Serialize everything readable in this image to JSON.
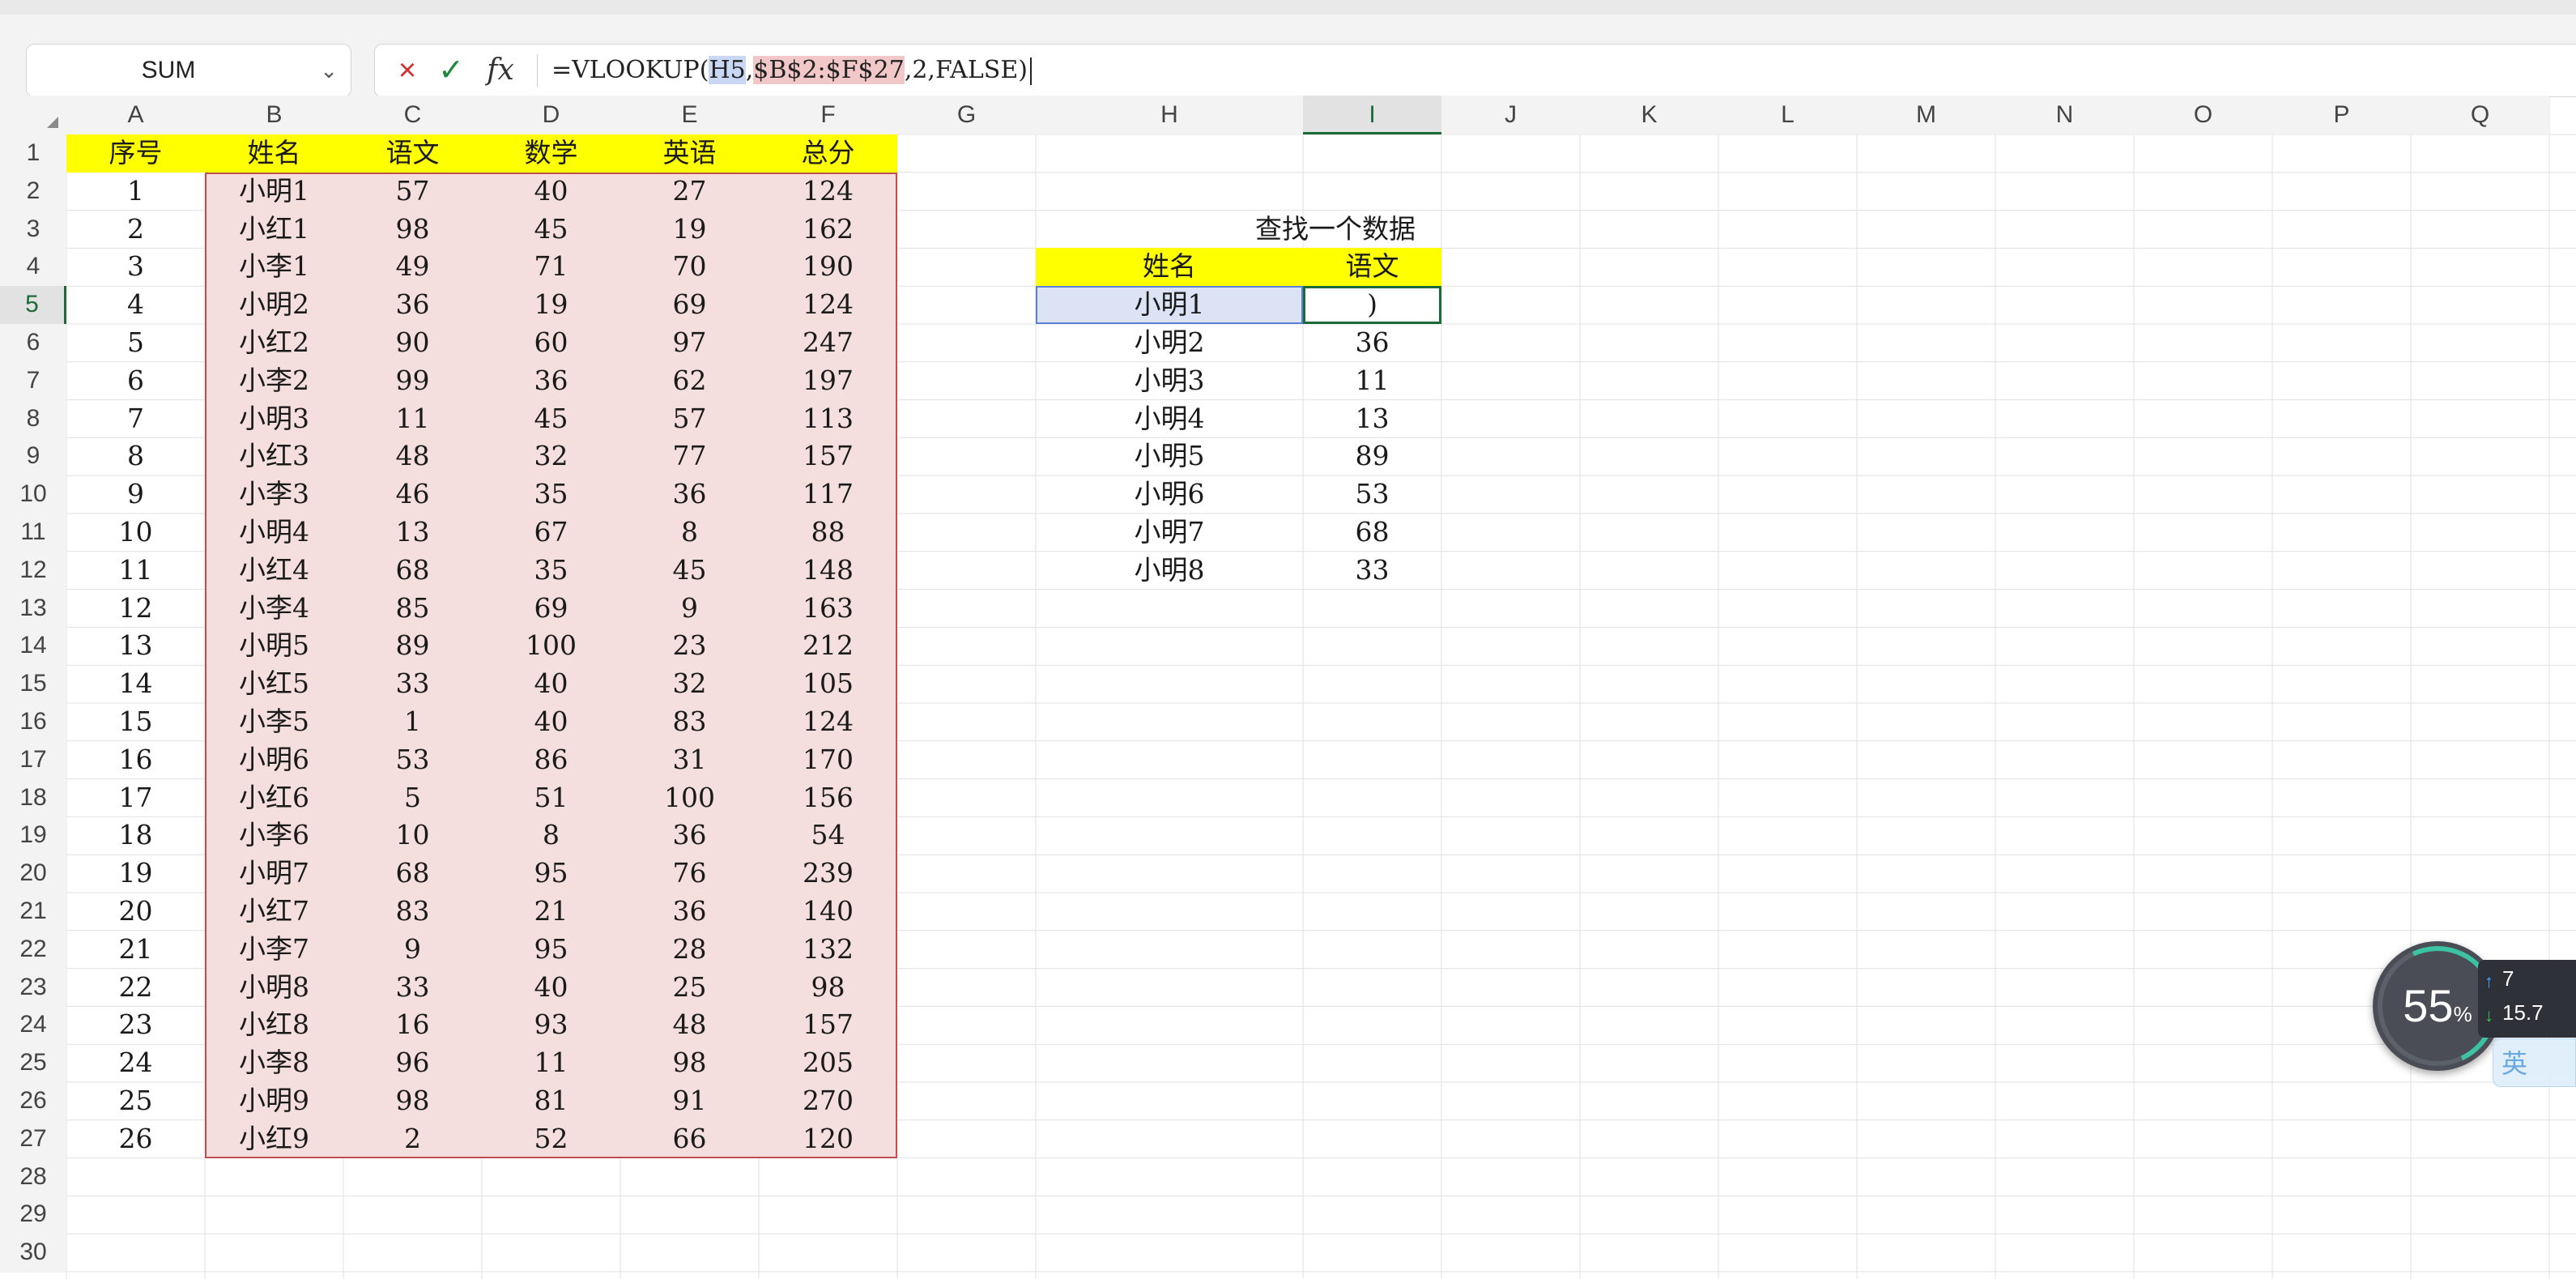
{
  "formula_bar": {
    "name_box": "SUM",
    "cancel_icon": "×",
    "confirm_icon": "✓",
    "fx_label": "fx",
    "formula_prefix": "=VLOOKUP(",
    "formula_ref1": "H5",
    "formula_sep1": ",",
    "formula_ref2": "$B$2:$F$27",
    "formula_suffix": ",2,FALSE)"
  },
  "columns": [
    "A",
    "B",
    "C",
    "D",
    "E",
    "F",
    "G",
    "H",
    "I",
    "J",
    "K",
    "L",
    "M",
    "N",
    "O",
    "P",
    "Q"
  ],
  "row_numbers": [
    "1",
    "2",
    "3",
    "4",
    "5",
    "6",
    "7",
    "8",
    "9",
    "10",
    "11",
    "12",
    "13",
    "14",
    "15",
    "16",
    "17",
    "18",
    "19",
    "20",
    "21",
    "22",
    "23",
    "24",
    "25",
    "26",
    "27",
    "28",
    "29",
    "30"
  ],
  "active_cell": {
    "column": "I",
    "row": "5"
  },
  "main_table": {
    "headers": [
      "序号",
      "姓名",
      "语文",
      "数学",
      "英语",
      "总分"
    ],
    "rows": [
      [
        "1",
        "小明1",
        "57",
        "40",
        "27",
        "124"
      ],
      [
        "2",
        "小红1",
        "98",
        "45",
        "19",
        "162"
      ],
      [
        "3",
        "小李1",
        "49",
        "71",
        "70",
        "190"
      ],
      [
        "4",
        "小明2",
        "36",
        "19",
        "69",
        "124"
      ],
      [
        "5",
        "小红2",
        "90",
        "60",
        "97",
        "247"
      ],
      [
        "6",
        "小李2",
        "99",
        "36",
        "62",
        "197"
      ],
      [
        "7",
        "小明3",
        "11",
        "45",
        "57",
        "113"
      ],
      [
        "8",
        "小红3",
        "48",
        "32",
        "77",
        "157"
      ],
      [
        "9",
        "小李3",
        "46",
        "35",
        "36",
        "117"
      ],
      [
        "10",
        "小明4",
        "13",
        "67",
        "8",
        "88"
      ],
      [
        "11",
        "小红4",
        "68",
        "35",
        "45",
        "148"
      ],
      [
        "12",
        "小李4",
        "85",
        "69",
        "9",
        "163"
      ],
      [
        "13",
        "小明5",
        "89",
        "100",
        "23",
        "212"
      ],
      [
        "14",
        "小红5",
        "33",
        "40",
        "32",
        "105"
      ],
      [
        "15",
        "小李5",
        "1",
        "40",
        "83",
        "124"
      ],
      [
        "16",
        "小明6",
        "53",
        "86",
        "31",
        "170"
      ],
      [
        "17",
        "小红6",
        "5",
        "51",
        "100",
        "156"
      ],
      [
        "18",
        "小李6",
        "10",
        "8",
        "36",
        "54"
      ],
      [
        "19",
        "小明7",
        "68",
        "95",
        "76",
        "239"
      ],
      [
        "20",
        "小红7",
        "83",
        "21",
        "36",
        "140"
      ],
      [
        "21",
        "小李7",
        "9",
        "95",
        "28",
        "132"
      ],
      [
        "22",
        "小明8",
        "33",
        "40",
        "25",
        "98"
      ],
      [
        "23",
        "小红8",
        "16",
        "93",
        "48",
        "157"
      ],
      [
        "24",
        "小李8",
        "96",
        "11",
        "98",
        "205"
      ],
      [
        "25",
        "小明9",
        "98",
        "81",
        "91",
        "270"
      ],
      [
        "26",
        "小红9",
        "2",
        "52",
        "66",
        "120"
      ]
    ]
  },
  "lookup_table": {
    "title": "查找一个数据",
    "headers": [
      "姓名",
      "语文"
    ],
    "rows": [
      [
        "小明1",
        ")"
      ],
      [
        "小明2",
        "36"
      ],
      [
        "小明3",
        "11"
      ],
      [
        "小明4",
        "13"
      ],
      [
        "小明5",
        "89"
      ],
      [
        "小明6",
        "53"
      ],
      [
        "小明7",
        "68"
      ],
      [
        "小明8",
        "33"
      ]
    ]
  },
  "perf_widget": {
    "percent": "55",
    "percent_unit": "%",
    "upload": "7",
    "download": "15.7"
  },
  "ime_badge": "英",
  "colors": {
    "header_yellow": "#ffff00",
    "range_pink": "#f4dede",
    "ref_blue": "#dbe3f5",
    "active_green": "#1c6b37"
  }
}
